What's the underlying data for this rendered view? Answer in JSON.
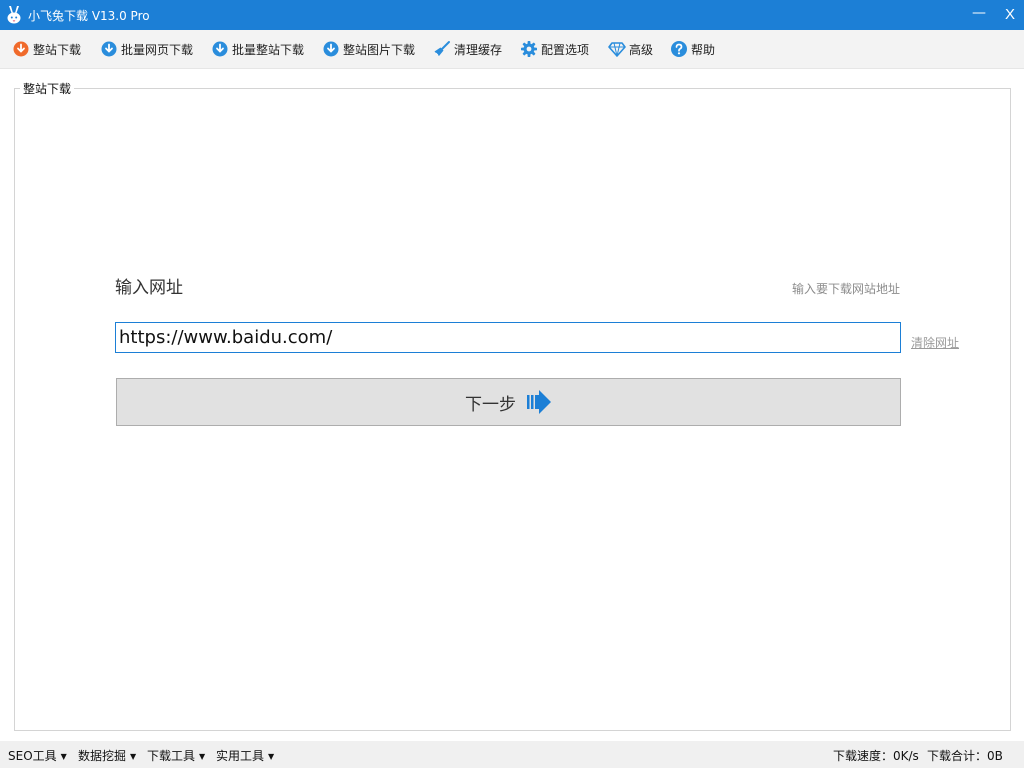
{
  "window": {
    "title": "小飞兔下载 V13.0 Pro",
    "minimize_label": "—",
    "close_label": "X"
  },
  "toolbar": {
    "items": [
      {
        "label": "整站下载",
        "icon": "download-icon",
        "color": "#f06a2b"
      },
      {
        "label": "批量网页下载",
        "icon": "download-icon",
        "color": "#2a8ddc"
      },
      {
        "label": "批量整站下载",
        "icon": "download-icon",
        "color": "#2a8ddc"
      },
      {
        "label": "整站图片下载",
        "icon": "download-icon",
        "color": "#2a8ddc"
      },
      {
        "label": "清理缓存",
        "icon": "broom-icon",
        "color": "#2a8ddc"
      },
      {
        "label": "配置选项",
        "icon": "gear-icon",
        "color": "#2a8ddc"
      },
      {
        "label": "高级",
        "icon": "diamond-icon",
        "color": "#2a8ddc"
      },
      {
        "label": "帮助",
        "icon": "help-icon",
        "color": "#2a8ddc"
      }
    ]
  },
  "panel": {
    "title": "整站下载",
    "url_label": "输入网址",
    "hint": "输入要下载网站地址",
    "url_value": "https://www.baidu.com/",
    "clear_label": "清除网址",
    "next_label": "下一步",
    "accent_color": "#1c7fd6"
  },
  "statusbar": {
    "menus": [
      "SEO工具",
      "数据挖掘",
      "下载工具",
      "实用工具"
    ],
    "speed": "下载速度：0K/s",
    "total": "下载合计：0B"
  }
}
